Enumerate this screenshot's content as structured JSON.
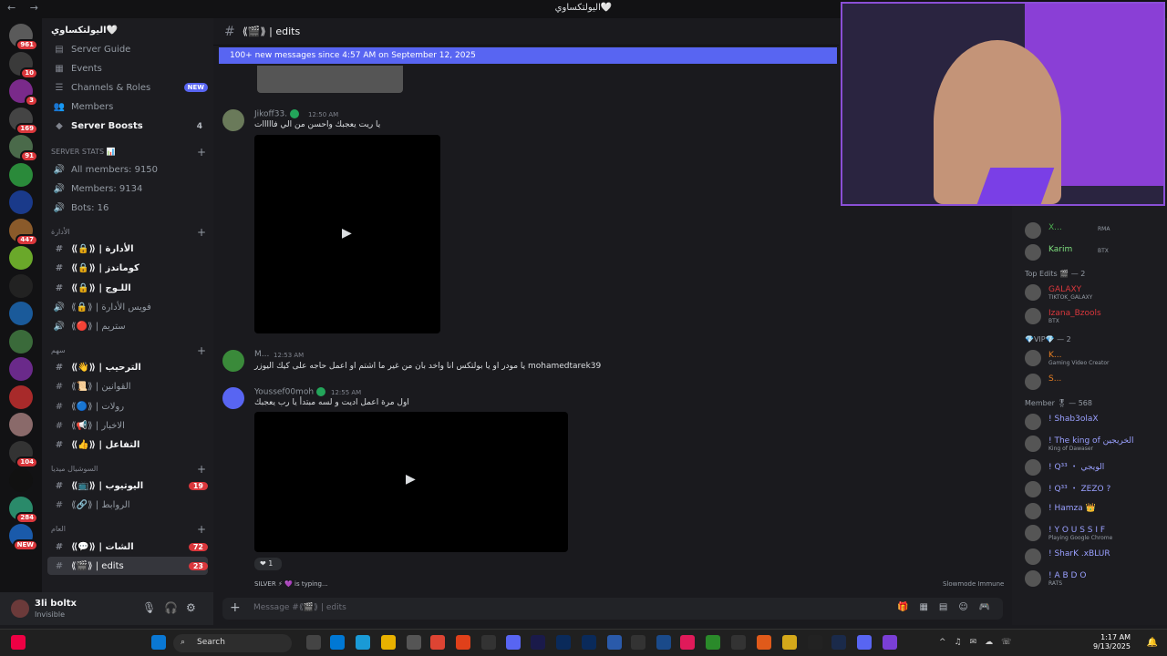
{
  "window": {
    "title": "اليولتكساوي🤍"
  },
  "server": {
    "name": "اليولتكساوي🤍",
    "top_items": [
      {
        "label": "Server Guide",
        "icon": "book-icon"
      },
      {
        "label": "Events",
        "icon": "calendar-icon"
      },
      {
        "label": "Channels & Roles",
        "icon": "list-icon",
        "tag": "NEW"
      },
      {
        "label": "Members",
        "icon": "people-icon"
      },
      {
        "label": "Server Boosts",
        "icon": "boost-icon",
        "count": "4"
      }
    ],
    "stats_category": "SERVER STATS 📊",
    "stats": [
      {
        "label": "All members: 9150"
      },
      {
        "label": "Members: 9134"
      },
      {
        "label": "Bots: 16"
      }
    ],
    "cat1": "الأدارة",
    "cat1_channels": [
      "⟪🔒⟫ | الأدارة",
      "⟪🔒⟫ | كوماندز",
      "⟪🔒⟫ | اللـوج",
      "⟪🔒⟫ | فويس الأدارة",
      "⟪🔴⟫ | ستريم"
    ],
    "cat2": "سهم",
    "cat2_channels": [
      "⟪👋⟫ | الترحيب",
      "⟪📜⟫ | القوانين",
      "⟪🔵⟫ | رولات",
      "⟪📢⟫ | الاخبار",
      "⟪👍⟫ | التفاعل"
    ],
    "cat3": "السوشيال ميديا",
    "cat3_channels": [
      {
        "label": "⟪📺⟫ | اليوتيوب",
        "count": "19"
      },
      {
        "label": "⟪🔗⟫ | الروابط"
      }
    ],
    "cat4": "العام",
    "cat4_channels": [
      {
        "label": "⟪💬⟫ | الشات",
        "count": "72"
      },
      {
        "label": "⟪🎬⟫ | edits",
        "count": "23"
      }
    ]
  },
  "servers": [
    {
      "badge": "961",
      "color": "#5a5a5a"
    },
    {
      "badge": "10",
      "color": "#3a3a3a"
    },
    {
      "badge": "3",
      "color": "#7a2a8a"
    },
    {
      "badge": "169",
      "color": "#444"
    },
    {
      "badge": "91",
      "color": "#4a6a4a"
    },
    {
      "badge": "",
      "color": "#2a8a3a"
    },
    {
      "badge": "",
      "color": "#1a3a8a"
    },
    {
      "badge": "447",
      "color": "#8a5a2a"
    },
    {
      "badge": "",
      "color": "#6aa82a"
    },
    {
      "badge": "",
      "color": "#222"
    },
    {
      "badge": "",
      "color": "#1a5a9a"
    },
    {
      "badge": "",
      "color": "#3a6a3a"
    },
    {
      "badge": "",
      "color": "#6a2a8a"
    },
    {
      "badge": "",
      "color": "#a82a2a"
    },
    {
      "badge": "",
      "color": "#8a6a6a"
    },
    {
      "badge": "104",
      "color": "#333"
    },
    {
      "badge": "",
      "color": "#111"
    },
    {
      "badge": "284",
      "color": "#2a8a6a"
    },
    {
      "badge": "NEW",
      "color": "#1a5aaa"
    }
  ],
  "user": {
    "name": "3li boltx",
    "status": "Invisible"
  },
  "chat": {
    "channel": "⟪🎬⟫ | edits",
    "new_messages": "100+ new messages since 4:57 AM on September 12, 2025",
    "messages": [
      {
        "author": "Jikoff33.",
        "time": "12:50 AM",
        "text": "يا ريت يعجبك واحسن من الي فااااات",
        "avatar": "#6a7a5a"
      },
      {
        "author": "M...",
        "time": "12:53 AM",
        "text": "يا مودر او يا بولتكس انا واخد بان من غير ما اشتم او اعمل حاجه على كيك اليوزر mohamedtarek39",
        "avatar": "#3a8a3a"
      },
      {
        "author": "Youssef00moh",
        "time": "12:55 AM",
        "text": "اول مرة اعمل اديت و لسه مبتدأ يا رب يعجبك",
        "avatar": "#5865f2"
      }
    ],
    "reaction_count": "1",
    "typing": "SILVER ⚡ 💜 is typing...",
    "slowmode": "Slowmode Immune",
    "composer_placeholder": "Message #⟪🎬⟫ | edits"
  },
  "members": {
    "top": [
      {
        "name": "X...",
        "tag": "RMA",
        "color": "#4caf50"
      },
      {
        "name": "Karim",
        "tag": "BTX",
        "color": "#7ee07e"
      }
    ],
    "groups": [
      {
        "title": "Top Edits 🎬 — 2",
        "items": [
          {
            "name": "GALAXY",
            "status": "TIKTOK_GALAXY",
            "color": "#da373c"
          },
          {
            "name": "Izana_Bzools",
            "status": "BTX",
            "color": "#da373c"
          }
        ]
      },
      {
        "title": "💎VIP💎 — 2",
        "items": [
          {
            "name": "K...",
            "status": "Gaming Video Creator",
            "color": "#e67e22"
          },
          {
            "name": "S...",
            "status": "",
            "color": "#e67e22"
          }
        ]
      },
      {
        "title": "Member 🎖 — 568",
        "items": [
          {
            "name": "! Shab3olaX",
            "status": "",
            "color": "#9aa0ff"
          },
          {
            "name": "! The king of الخريجين",
            "status": "King of Dawaser",
            "color": "#9aa0ff"
          },
          {
            "name": "! Q³³ ・ الويجي",
            "status": "",
            "color": "#9aa0ff"
          },
          {
            "name": "! Q³³ ・ ZEZO ?",
            "status": "",
            "color": "#9aa0ff"
          },
          {
            "name": "! Hamza 👑",
            "status": "",
            "color": "#9aa0ff"
          },
          {
            "name": "! Y O U S S I F",
            "status": "Playing Google Chrome",
            "color": "#9aa0ff"
          },
          {
            "name": "! SharK .xBLUR",
            "status": "",
            "color": "#9aa0ff"
          },
          {
            "name": "! A B D O",
            "status": "RATS",
            "color": "#9aa0ff"
          }
        ]
      }
    ]
  },
  "taskbar": {
    "search": "Search",
    "time": "1:17 AM",
    "date": "9/13/2025"
  }
}
